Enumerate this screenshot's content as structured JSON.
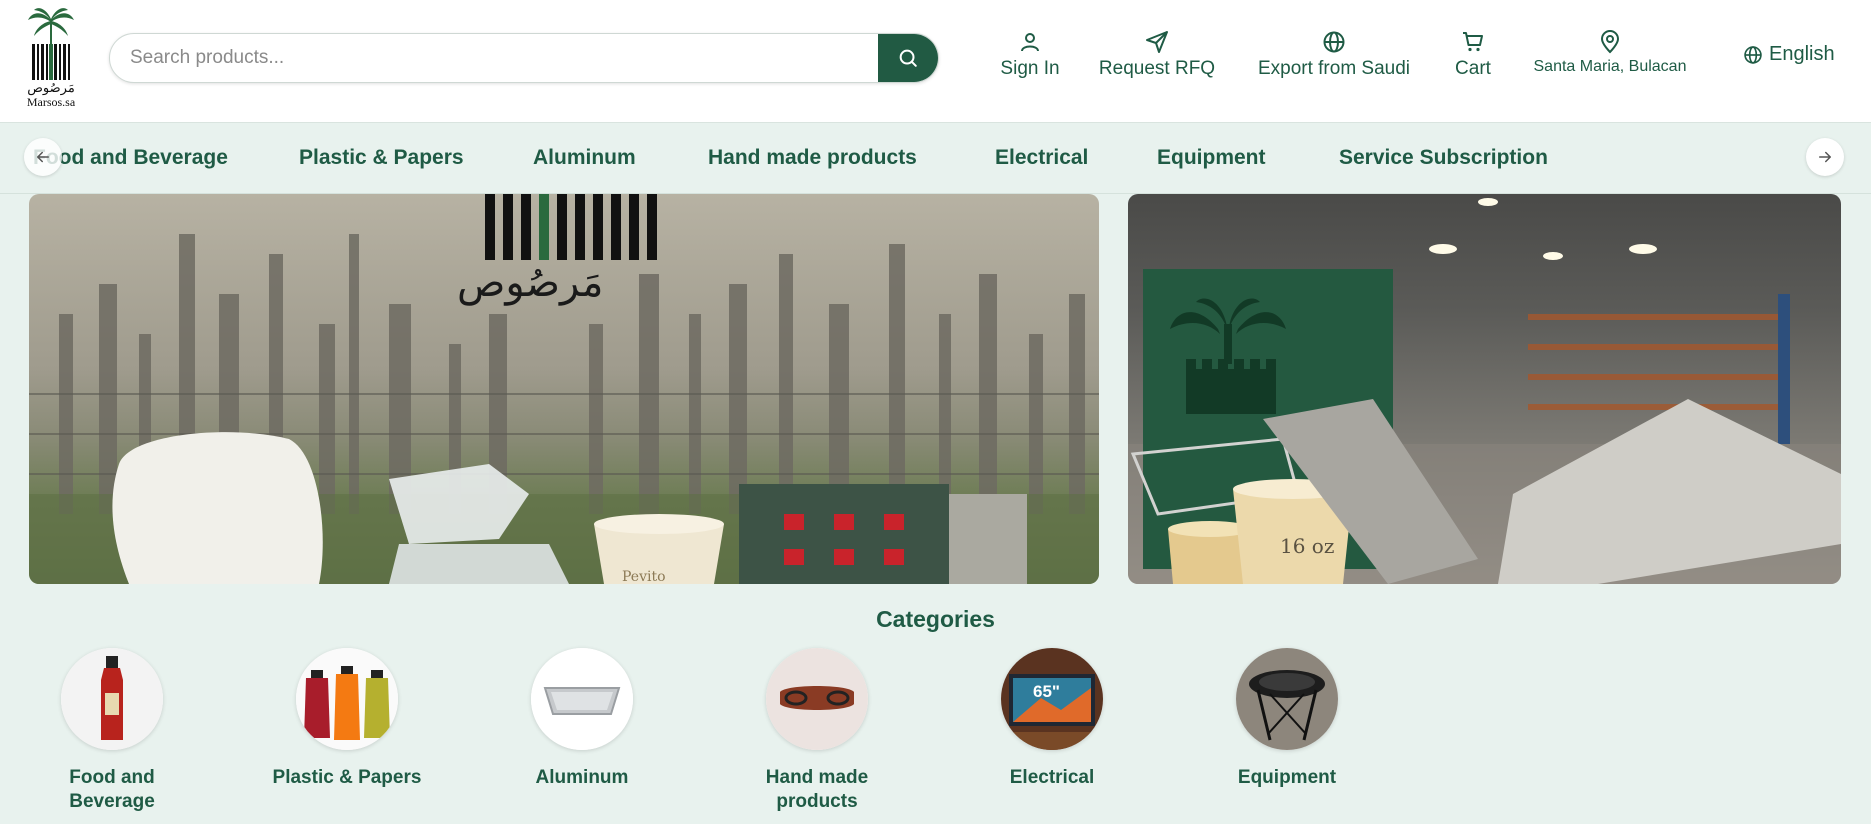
{
  "brand": {
    "arabic_name": "مَرصُوص",
    "site_name": "Marsos.sa"
  },
  "search": {
    "placeholder": "Search products..."
  },
  "nav": {
    "sign_in": "Sign In",
    "request_rfq": "Request RFQ",
    "export": "Export from Saudi",
    "cart": "Cart",
    "location": "Santa Maria, Bulacan"
  },
  "language": "English",
  "category_bar": [
    "Food and Beverage",
    "Plastic & Papers",
    "Aluminum",
    "Hand made products",
    "Electrical",
    "Equipment",
    "Service Subscription"
  ],
  "banners": {
    "left_brand_text": "مَرصُوص",
    "right_cup_label": "16 oz",
    "left_cup_label": "Pevito"
  },
  "categories_section": {
    "heading": "Categories",
    "items": [
      {
        "name": "Food and Beverage",
        "icon": "bottle-image"
      },
      {
        "name": "Plastic & Papers",
        "icon": "juice-bottles-image"
      },
      {
        "name": "Aluminum",
        "icon": "aluminum-tray-image"
      },
      {
        "name": "Hand made products",
        "icon": "leather-organizer-image"
      },
      {
        "name": "Electrical",
        "icon": "tv-image"
      },
      {
        "name": "Equipment",
        "icon": "fire-pit-image"
      }
    ],
    "tv_label": "65\""
  },
  "colors": {
    "primary": "#215a43",
    "background": "#e8f2ee",
    "header_bg": "#ffffff"
  }
}
